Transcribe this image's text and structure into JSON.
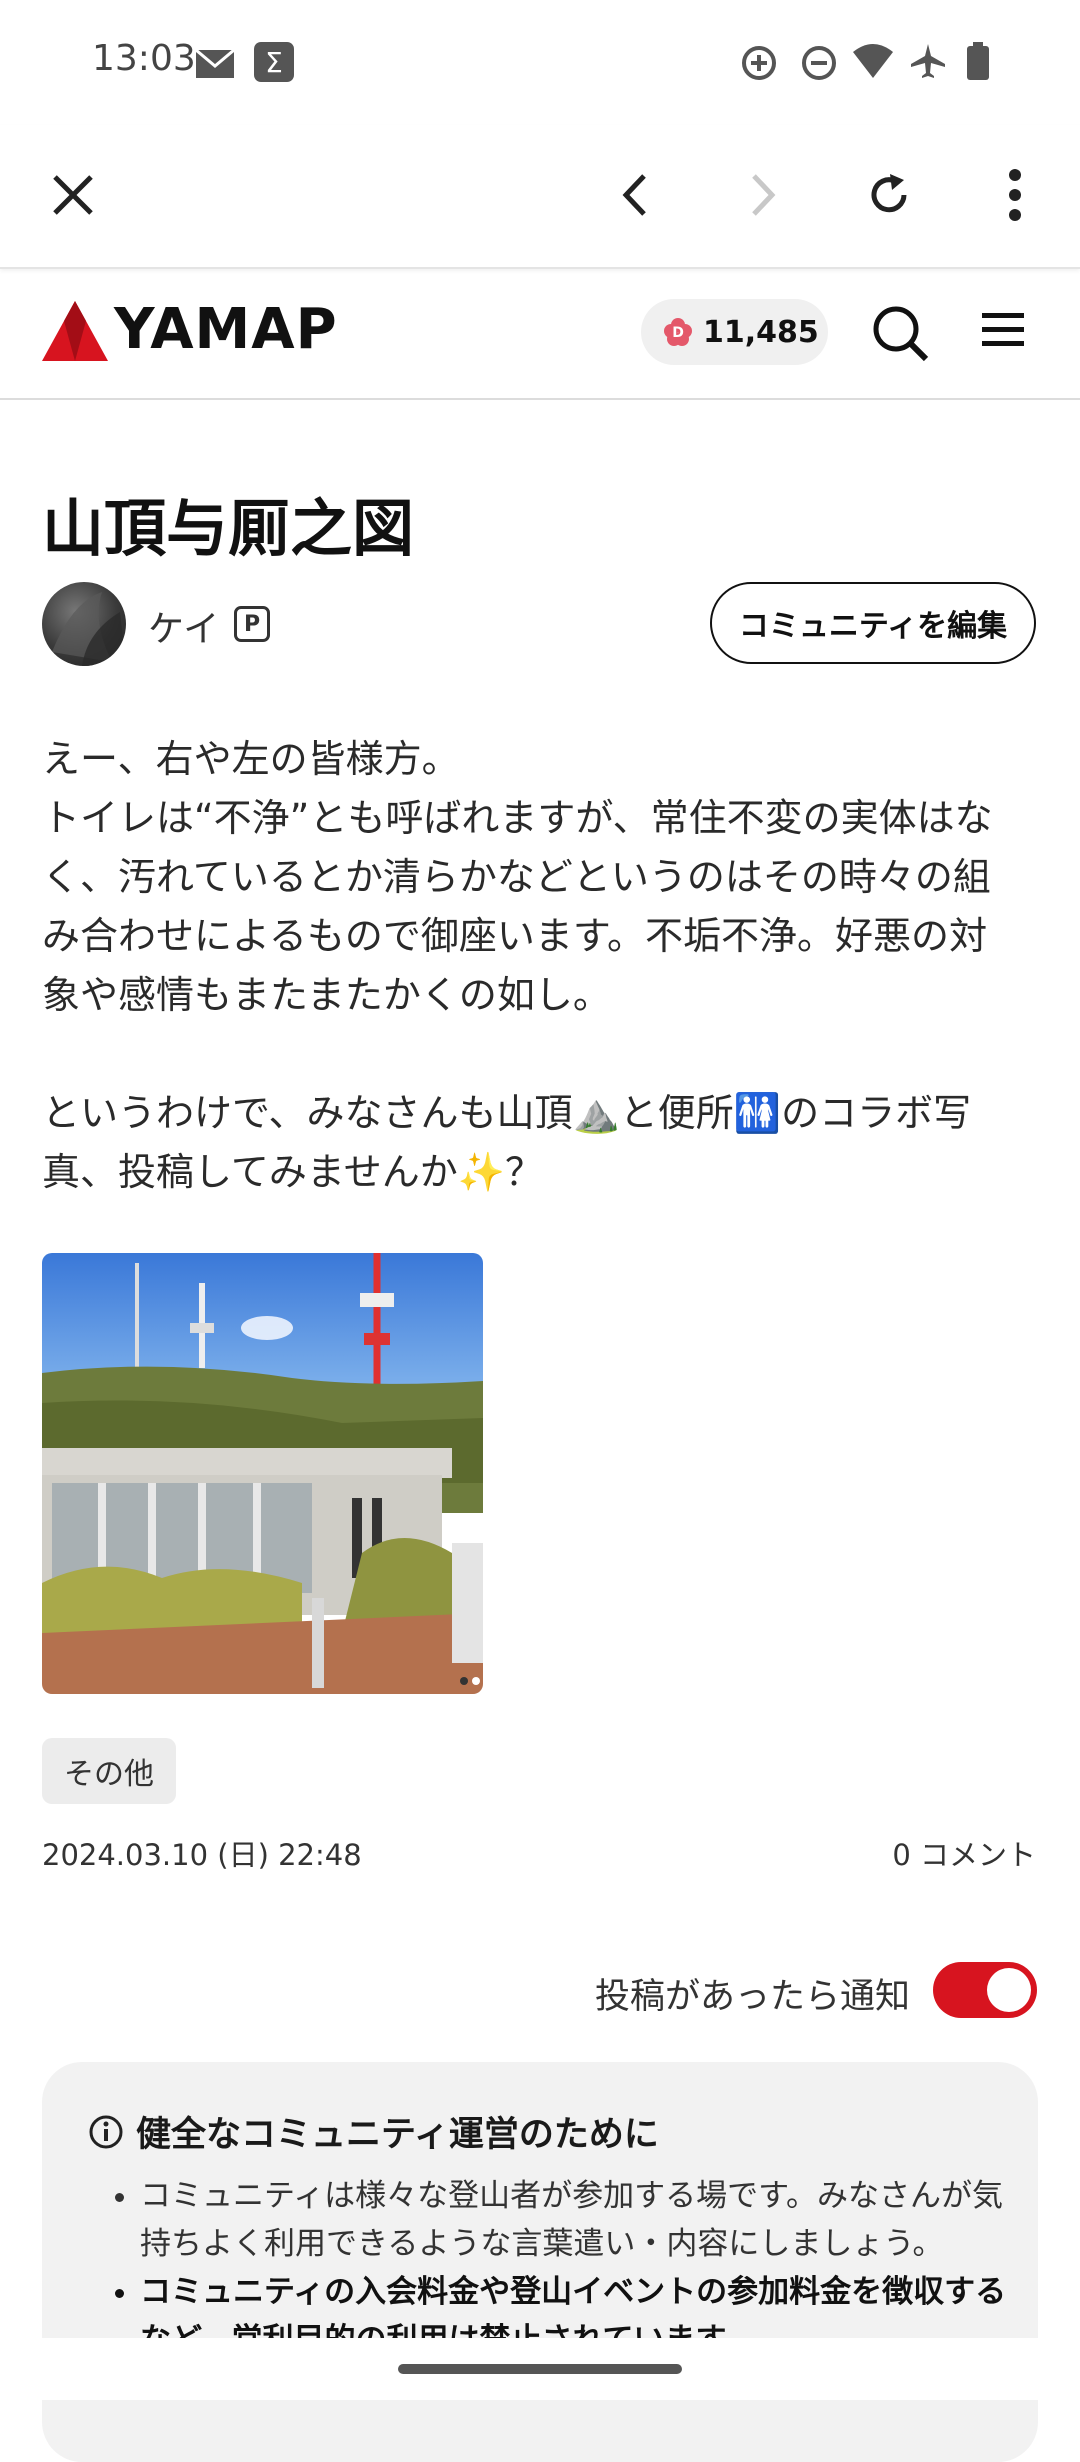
{
  "status_bar": {
    "time": "13:03",
    "left_icons": [
      "mail-icon",
      "sigma-app-icon"
    ],
    "right_icons": [
      "data-saver-icon",
      "do-not-disturb-icon",
      "wifi-icon",
      "airplane-icon",
      "battery-icon"
    ]
  },
  "browser_toolbar": {
    "icons": [
      "close-icon",
      "back-icon",
      "forward-icon",
      "reload-icon",
      "more-vert-icon"
    ]
  },
  "site_header": {
    "logo_text": "YAMAP",
    "points": "11,485",
    "icons": [
      "search-icon",
      "menu-icon"
    ],
    "accent_color": "#d7141f"
  },
  "post": {
    "title": "山頂与厠之図",
    "author": "ケイ",
    "author_badge": "P",
    "edit_button": "コミュニティを編集",
    "body": [
      "えー、右や左の皆様方。",
      "トイレは“不浄”とも呼ばれますが、常住不変の実体はな",
      "く、汚れているとか清らかなどというのはその時々の組",
      "み合わせによるもので御座います。不垢不浄。好悪の対",
      "象や感情もまたまたかくの如し。",
      "",
      "というわけで、みなさんも山頂⛰️と便所🚻のコラボ写",
      "真、投稿してみませんか✨？"
    ],
    "tag": "その他",
    "date": "2024.03.10 (日) 22:48",
    "comments": "0 コメント",
    "notify_label": "投稿があったら通知",
    "notify_on": true
  },
  "guidelines": {
    "title": "健全なコミュニティ運営のために",
    "items": [
      {
        "text": "コミュニティは様々な登山者が参加する場です。みなさんが気持ちよく利用できるような言葉遣い・内容にしましょう。",
        "bold": false
      },
      {
        "text": "コミュニティの入会料金や登山イベントの参加料金を徴収するなど、営利目的の利用は禁止されています。",
        "bold": true
      }
    ]
  }
}
